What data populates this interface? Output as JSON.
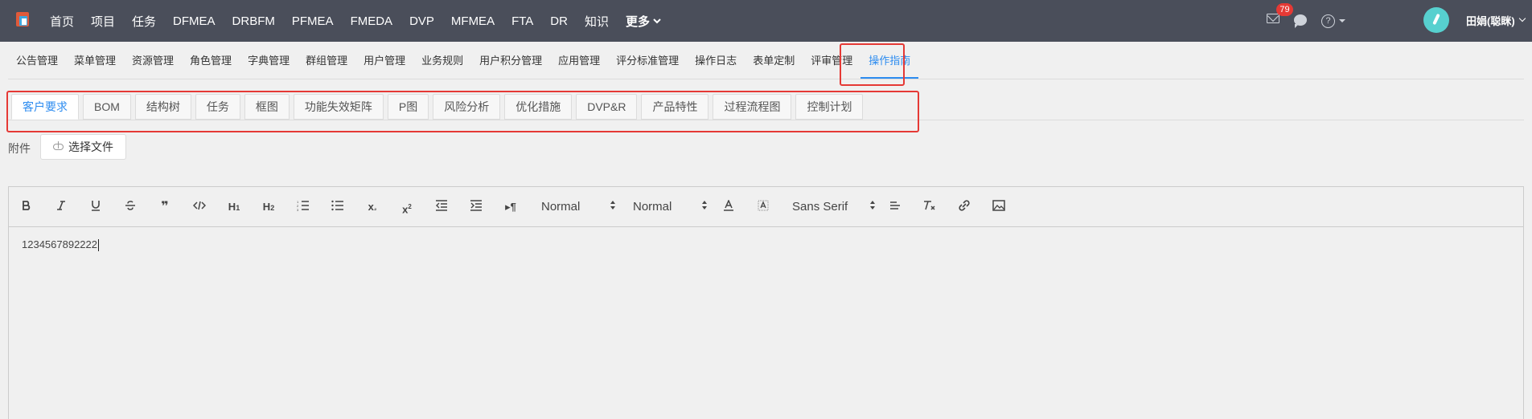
{
  "topnav": {
    "items": [
      "首页",
      "项目",
      "任务",
      "DFMEA",
      "DRBFM",
      "PFMEA",
      "FMEDA",
      "DVP",
      "MFMEA",
      "FTA",
      "DR",
      "知识"
    ],
    "more_label": "更多",
    "mail_badge": "79",
    "username": "田娟(聪眯)"
  },
  "menu_tabs": [
    "公告管理",
    "菜单管理",
    "资源管理",
    "角色管理",
    "字典管理",
    "群组管理",
    "用户管理",
    "业务规则",
    "用户积分管理",
    "应用管理",
    "评分标准管理",
    "操作日志",
    "表单定制",
    "评审管理",
    "操作指南"
  ],
  "menu_active": "操作指南",
  "sub_tabs": [
    "客户要求",
    "BOM",
    "结构树",
    "任务",
    "框图",
    "功能失效矩阵",
    "P图",
    "风险分析",
    "优化措施",
    "DVP&R",
    "产品特性",
    "过程流程图",
    "控制计划"
  ],
  "sub_active": "客户要求",
  "attachment": {
    "label": "附件",
    "upload_label": "选择文件"
  },
  "editor": {
    "header_select": "Normal",
    "size_select": "Normal",
    "font_select": "Sans Serif",
    "content": "1234567892222"
  },
  "colors": {
    "nav_bg": "#4a4e5a",
    "accent": "#2d8cf0",
    "highlight": "#e53935"
  }
}
